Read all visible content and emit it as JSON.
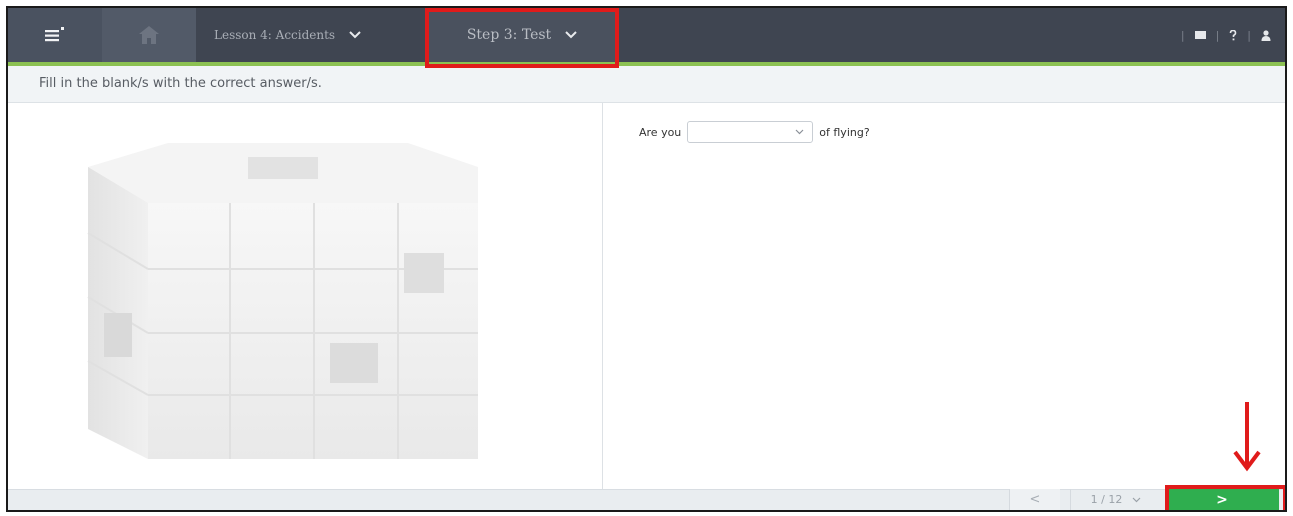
{
  "header": {
    "lesson_label": "Lesson 4: Accidents",
    "step_label": "Step 3: Test",
    "chevron": "⌵"
  },
  "instruction": "Fill in the blank/s with the correct answer/s.",
  "question": {
    "before": "Are you",
    "dropdown_value": "",
    "after": "of flying?"
  },
  "pager": {
    "prev_symbol": "<",
    "page_indicator": "1 / 12",
    "next_symbol": ">"
  },
  "icons": [
    "menu-icon",
    "home-icon",
    "chevron-down-icon",
    "mail-icon",
    "help-icon",
    "user-icon"
  ],
  "colors": {
    "header_bg": "#3f4551",
    "accent_green": "#8cc152",
    "next_button": "#2fae4f",
    "highlight_red": "#e01b1b"
  }
}
